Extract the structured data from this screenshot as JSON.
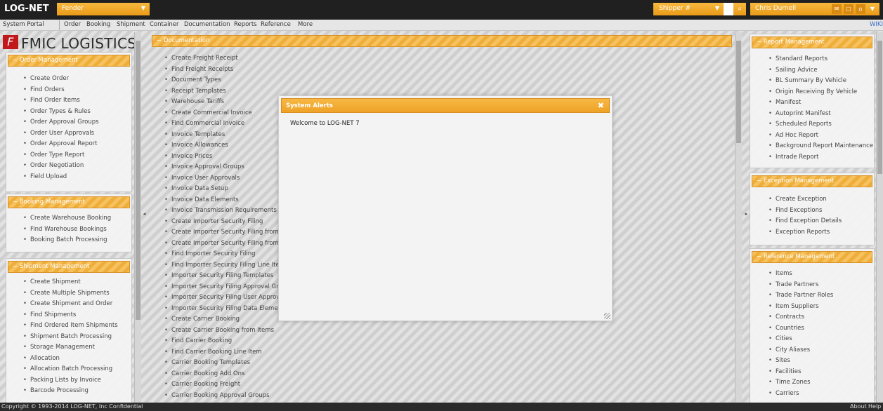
{
  "topbar": {
    "app_name": "LOG-NET",
    "company": "Fender",
    "shipper_label": "Shipper #",
    "user_name": "Chris Durnell"
  },
  "menubar": {
    "portal": "System Portal",
    "items": [
      "Order",
      "Booking",
      "Shipment",
      "Container",
      "Documentation",
      "Reports",
      "Reference",
      "More"
    ],
    "wiki": "WIKI"
  },
  "left": {
    "logo_text": "FMIC LOGISTICS",
    "order_management": {
      "title": "Order Management",
      "items": [
        "Create Order",
        "Find Orders",
        "Find Order Items",
        "Order Types & Rules",
        "Order Approval Groups",
        "Order User Approvals",
        "Order Approval Report",
        "Order Type Report",
        "Order Negotiation",
        "Field Upload"
      ]
    },
    "booking_management": {
      "title": "Booking Management",
      "items": [
        "Create Warehouse Booking",
        "Find Warehouse Bookings",
        "Booking Batch Processing"
      ]
    },
    "shipment_management": {
      "title": "Shipment Management",
      "items": [
        "Create Shipment",
        "Create Multiple Shipments",
        "Create Shipment and Order",
        "Find Shipments",
        "Find Ordered Item Shipments",
        "Shipment Batch Processing",
        "Storage Management",
        "Allocation",
        "Allocation Batch Processing",
        "Packing Lists by Invoice",
        "Barcode Processing"
      ]
    }
  },
  "center": {
    "documentation": {
      "title": "Documentation",
      "items": [
        "Create Freight Receipt",
        "Find Freight Receipts",
        "Document Types",
        "Receipt Templates",
        "Warehouse Tariffs",
        "Create Commercial Invoice",
        "Find Commercial Invoice",
        "Invoice Templates",
        "Invoice Allowances",
        "Invoice Prices",
        "Invoice Approval Groups",
        "Invoice User Approvals",
        "Invoice Data Setup",
        "Invoice Data Elements",
        "Invoice Transmission Requirements",
        "Create Importer Security Filing",
        "Create Importer Security Filing from I",
        "Create Importer Security Filing from S",
        "Find Importer Security Filing",
        "Find Importer Security Filing Line Item",
        "Importer Security Filing Templates",
        "Importer Security Filing Approval Grou",
        "Importer Security Filing User Approval",
        "Importer Security Filing Data Elements",
        "Create Carrier Booking",
        "Create Carrier Booking from Items",
        "Find Carrier Booking",
        "Find Carrier Booking Line Item",
        "Carrier Booking Templates",
        "Carrier Booking Add Ons",
        "Carrier Booking Freight",
        "Carrier Booking Approval Groups"
      ]
    }
  },
  "right": {
    "report_management": {
      "title": "Report Management",
      "items": [
        "Standard Reports",
        "Sailing Advice",
        "BL Summary By Vehicle",
        "Origin Receiving By Vehicle",
        "Manifest",
        "Autoprint Manifest",
        "Scheduled Reports",
        "Ad Hoc Report",
        "Background Report Maintenance",
        "Intrade Report"
      ]
    },
    "exception_management": {
      "title": "Exception Management",
      "items": [
        "Create Exception",
        "Find Exceptions",
        "Find Exception Details",
        "Exception Reports"
      ]
    },
    "reference_management": {
      "title": "Reference Management",
      "items": [
        "Items",
        "Trade Partners",
        "Trade Partner Roles",
        "Item Suppliers",
        "Contracts",
        "Countries",
        "Cities",
        "City Aliases",
        "Sites",
        "Facilities",
        "Time Zones",
        "Carriers"
      ]
    }
  },
  "modal": {
    "title": "System Alerts",
    "message": "Welcome to LOG-NET 7"
  },
  "footer": {
    "copyright": "Copyright © 1993-2014 LOG-NET, Inc Confidential",
    "about": "About",
    "help": "Help"
  }
}
